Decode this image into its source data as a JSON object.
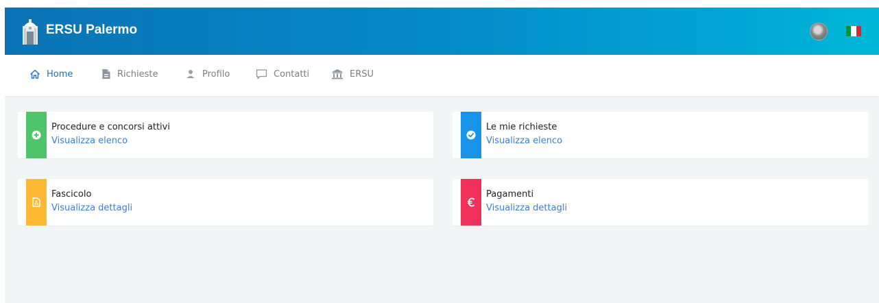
{
  "app": {
    "title": "ERSU Palermo"
  },
  "header": {
    "language_flag_colors": [
      "#009246",
      "#ffffff",
      "#ce2b37"
    ]
  },
  "nav": {
    "items": [
      {
        "label": "Home",
        "icon": "home-icon",
        "active": true
      },
      {
        "label": "Richieste",
        "icon": "document-icon",
        "active": false
      },
      {
        "label": "Profilo",
        "icon": "user-icon",
        "active": false
      },
      {
        "label": "Contatti",
        "icon": "chat-icon",
        "active": false
      },
      {
        "label": "ERSU",
        "icon": "institution-icon",
        "active": false
      }
    ]
  },
  "cards": [
    {
      "title": "Procedure e concorsi attivi",
      "link": "Visualizza elenco",
      "icon": "plus-circle-icon",
      "color": "#4ec46b"
    },
    {
      "title": "Le mie richieste",
      "link": "Visualizza elenco",
      "icon": "check-circle-icon",
      "color": "#1793ea"
    },
    {
      "title": "Fascicolo",
      "link": "Visualizza dettagli",
      "icon": "pdf-file-icon",
      "color": "#fdb936"
    },
    {
      "title": "Pagamenti",
      "link": "Visualizza dettagli",
      "icon": "euro-icon",
      "color": "#f0325a"
    }
  ],
  "colors": {
    "accent": "#1a6fc7",
    "header_start": "#0a73b5",
    "header_end": "#00b7d8",
    "background": "#f1f5f6"
  }
}
